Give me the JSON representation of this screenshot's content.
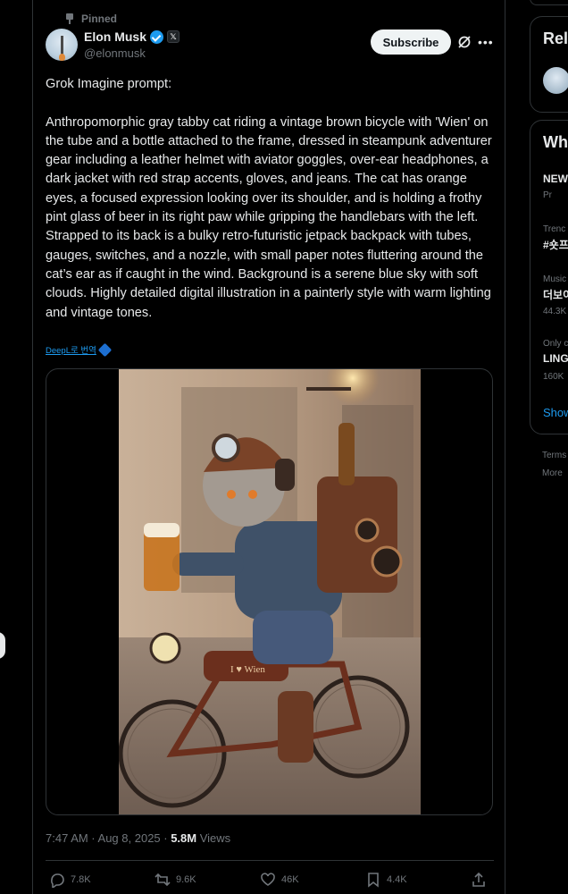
{
  "colors": {
    "background": "#000000",
    "text_primary": "#e7e9ea",
    "text_secondary": "#71767b",
    "accent_blue": "#1d9bf0",
    "border": "#2f3336"
  },
  "tweet": {
    "pinned_label": "Pinned",
    "author": {
      "display_name": "Elon Musk",
      "handle": "@elonmusk",
      "verified_icon": "verified-badge-icon",
      "affiliation_badge": "𝕏"
    },
    "subscribe_label": "Subscribe",
    "text": "Grok Imagine prompt:\n\nAnthropomorphic gray tabby cat riding a vintage brown bicycle with 'Wien' on the tube and a bottle attached to the frame, dressed in steampunk adventurer gear including a leather helmet with aviator goggles, over-ear headphones, a dark jacket with red strap accents, gloves, and jeans. The cat has orange eyes, a focused expression looking over its shoulder, and is holding a frothy pint glass of beer in its right paw while gripping the handlebars with the left. Strapped to its back is a bulky retro-futuristic jetpack backpack with tubes, gauges, switches, and a nozzle, with small paper notes fluttering around the cat’s ear as if caught in the wind. Background is a serene blue sky with soft clouds. Highly detailed digital illustration in a painterly style with warm lighting and vintage tones.",
    "translate_label": "DeepL로 번역",
    "media_bicycle_text": "I ♥ Wien",
    "timestamp": "7:47 AM · Aug 8, 2025 · ",
    "views_count": "5.8M",
    "views_label": " Views",
    "actions": {
      "replies": "7.8K",
      "reposts": "9.6K",
      "likes": "46K",
      "bookmarks": "4.4K"
    }
  },
  "sidebar": {
    "relevant_title": "Rel",
    "whats_happening_title": "Wh",
    "items": [
      {
        "meta": "",
        "title": "NEW",
        "sub": "Pr"
      },
      {
        "meta": "Trenc",
        "title": "#숏프",
        "sub": ""
      },
      {
        "meta": "Music",
        "title": "더보이",
        "sub": "44.3K"
      },
      {
        "meta": "Only c",
        "title": "LING",
        "sub": "160K"
      }
    ],
    "show_more": "Show",
    "footer": [
      "Terms",
      "More"
    ]
  }
}
